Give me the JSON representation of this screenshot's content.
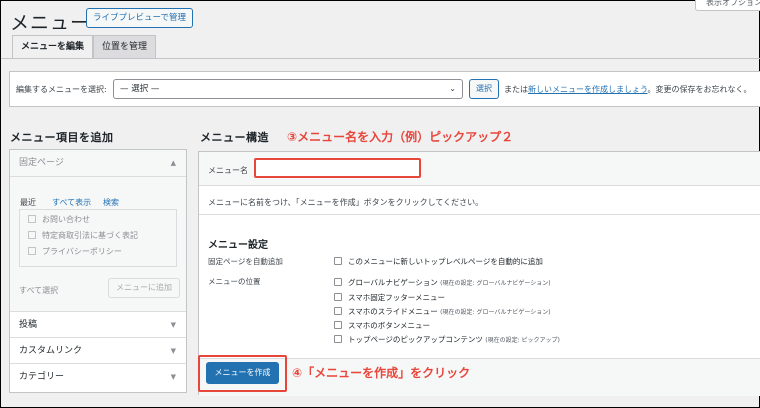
{
  "header": {
    "title": "メニュー",
    "live_preview_button": "ライブプレビューで管理",
    "screen_options": "表示オプション"
  },
  "tabs": [
    {
      "label": "メニューを編集",
      "active": true
    },
    {
      "label": "位置を管理",
      "active": false
    }
  ],
  "select_panel": {
    "label": "編集するメニューを選択:",
    "select_value": "— 選択 —",
    "select_button": "選択",
    "or_text": "または",
    "create_link": "新しいメニューを作成しましょう",
    "tail_text": "。変更の保存をお忘れなく。"
  },
  "left": {
    "heading": "メニュー項目を追加",
    "fixed_page": {
      "title": "固定ページ",
      "subtabs": [
        "最近",
        "すべて表示",
        "検索"
      ],
      "pages": [
        "お問い合わせ",
        "特定商取引法に基づく表記",
        "プライバシーポリシー"
      ],
      "select_all": "すべて選択",
      "add_button": "メニューに追加"
    },
    "accordions": [
      "投稿",
      "カスタムリンク",
      "カテゴリー"
    ]
  },
  "right": {
    "heading": "メニュー構造",
    "name_label": "メニュー名",
    "name_value": "",
    "instruction": "メニューに名前をつけ、「メニューを作成」ボタンをクリックしてください。",
    "settings_heading": "メニュー設定",
    "auto_add_label": "固定ページを自動追加",
    "auto_add_option": "このメニューに新しいトップレベルページを自動的に追加",
    "location_label": "メニューの位置",
    "locations": [
      {
        "label": "グローバルナビゲーション",
        "note": "(現在の設定: グローバルナビゲーション)"
      },
      {
        "label": "スマホ固定フッターメニュー",
        "note": ""
      },
      {
        "label": "スマホのスライドメニュー",
        "note": "(現在の設定: グローバルナビゲーション)"
      },
      {
        "label": "スマホのボタンメニュー",
        "note": ""
      },
      {
        "label": "トップページのピックアップコンテンツ",
        "note": "(現在の設定: ピックアップ)"
      }
    ],
    "create_button": "メニューを作成"
  },
  "annotations": {
    "step3": "③メニュー名を入力（例）ピックアップ２",
    "step4": "④「メニューを作成」をクリック"
  },
  "colors": {
    "accent": "#2271b1",
    "annotation": "#e8463b",
    "background": "#f0f0f1"
  }
}
